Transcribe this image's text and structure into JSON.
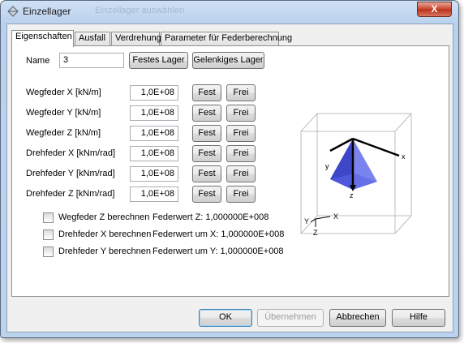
{
  "window": {
    "title": "Einzellager",
    "ghost_title": "Einzellager auswählen",
    "close_glyph": "X"
  },
  "tabs": [
    {
      "label": "Eigenschaften",
      "active": true
    },
    {
      "label": "Ausfall",
      "active": false
    },
    {
      "label": "Verdrehung",
      "active": false
    },
    {
      "label": "Parameter für Federberechnung",
      "active": false
    }
  ],
  "name": {
    "label": "Name",
    "value": "3",
    "fixed_button": "Festes Lager",
    "hinged_button": "Gelenkiges Lager"
  },
  "springs": [
    {
      "label": "Wegfeder X [kN/m]",
      "value": "1,0E+08",
      "fest": "Fest",
      "frei": "Frei"
    },
    {
      "label": "Wegfeder Y [kN/m]",
      "value": "1,0E+08",
      "fest": "Fest",
      "frei": "Frei"
    },
    {
      "label": "Wegfeder Z [kN/m]",
      "value": "1,0E+08",
      "fest": "Fest",
      "frei": "Frei"
    },
    {
      "label": "Drehfeder X [kNm/rad]",
      "value": "1,0E+08",
      "fest": "Fest",
      "frei": "Frei"
    },
    {
      "label": "Drehfeder Y [kNm/rad]",
      "value": "1,0E+08",
      "fest": "Fest",
      "frei": "Frei"
    },
    {
      "label": "Drehfeder Z [kNm/rad]",
      "value": "1,0E+08",
      "fest": "Fest",
      "frei": "Frei"
    }
  ],
  "calc": [
    {
      "label": "Wegfeder Z berechnen",
      "checked": false,
      "value_text": "Federwert Z: 1,000000E+008"
    },
    {
      "label": "Drehfeder X berechnen",
      "checked": false,
      "value_text": "Federwert um X: 1,000000E+008"
    },
    {
      "label": "Drehfeder Y berechnen",
      "checked": false,
      "value_text": "Federwert um Y: 1,000000E+008"
    }
  ],
  "viewport": {
    "axis_x": "x",
    "axis_y": "y",
    "axis_z": "z",
    "triad_x": "X",
    "triad_y": "Y",
    "triad_z": "Z",
    "pyramid_color": "#5a64e6"
  },
  "footer": {
    "ok": "OK",
    "apply": "Übernehmen",
    "cancel": "Abbrechen",
    "help": "Hilfe"
  }
}
